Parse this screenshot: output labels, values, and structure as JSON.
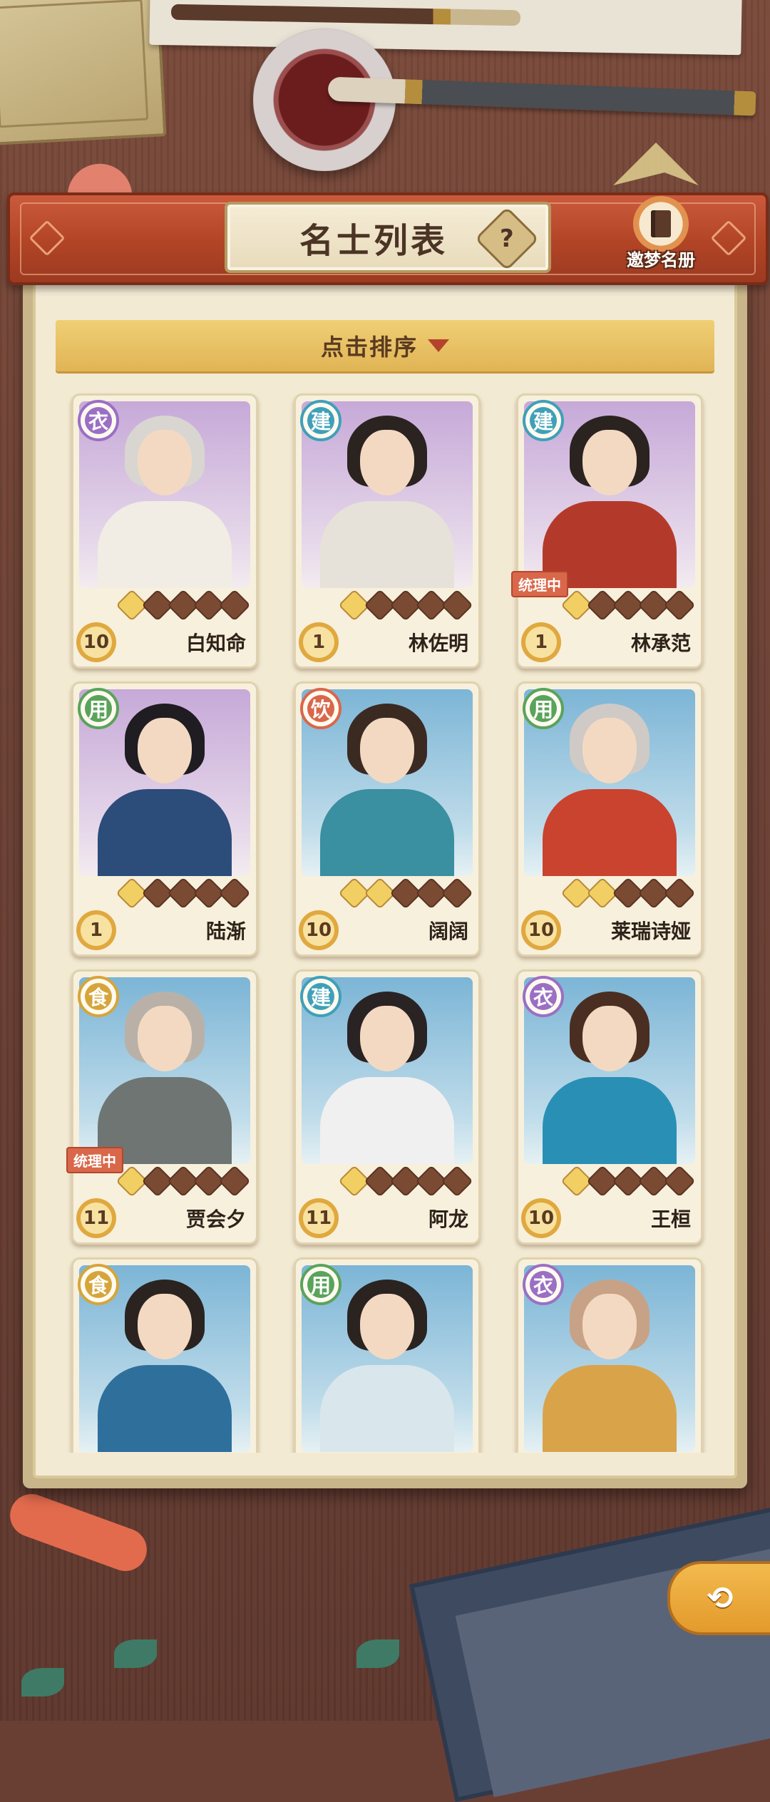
{
  "header": {
    "title": "名士列表",
    "help_icon_glyph": "?",
    "book_button_label": "邀梦名册"
  },
  "sort": {
    "label": "点击排序"
  },
  "status_tag_label": "统理中",
  "colors": {
    "header_red": "#b24426",
    "sort_gold": "#e0b455",
    "class_purple": "#9b6fc4",
    "class_teal": "#3fa0b8",
    "class_green": "#5aa35a",
    "class_red": "#d9674a",
    "class_gold": "#d6a53a"
  },
  "cards": [
    {
      "class_label": "衣",
      "class_color": "#9b6fc4",
      "level": "10",
      "stars": 1,
      "name": "白知命",
      "bg": "purple",
      "status": ""
    },
    {
      "class_label": "建",
      "class_color": "#3fa0b8",
      "level": "1",
      "stars": 1,
      "name": "林佐明",
      "bg": "purple",
      "status": ""
    },
    {
      "class_label": "建",
      "class_color": "#3fa0b8",
      "level": "1",
      "stars": 1,
      "name": "林承范",
      "bg": "purple",
      "status": "统理中"
    },
    {
      "class_label": "用",
      "class_color": "#5aa35a",
      "level": "1",
      "stars": 1,
      "name": "陆渐",
      "bg": "purple",
      "status": ""
    },
    {
      "class_label": "饮",
      "class_color": "#d9674a",
      "level": "10",
      "stars": 2,
      "name": "阔阔",
      "bg": "blue",
      "status": ""
    },
    {
      "class_label": "用",
      "class_color": "#5aa35a",
      "level": "10",
      "stars": 2,
      "name": "莱瑞诗娅",
      "bg": "blue",
      "status": ""
    },
    {
      "class_label": "食",
      "class_color": "#d6a53a",
      "level": "11",
      "stars": 1,
      "name": "贾会夕",
      "bg": "blue",
      "status": "统理中"
    },
    {
      "class_label": "建",
      "class_color": "#3fa0b8",
      "level": "11",
      "stars": 1,
      "name": "阿龙",
      "bg": "blue",
      "status": ""
    },
    {
      "class_label": "衣",
      "class_color": "#9b6fc4",
      "level": "10",
      "stars": 1,
      "name": "王桓",
      "bg": "blue",
      "status": ""
    },
    {
      "class_label": "食",
      "class_color": "#d6a53a",
      "level": "",
      "stars": 0,
      "name": "",
      "bg": "blue",
      "status": ""
    },
    {
      "class_label": "用",
      "class_color": "#5aa35a",
      "level": "",
      "stars": 0,
      "name": "",
      "bg": "blue",
      "status": ""
    },
    {
      "class_label": "衣",
      "class_color": "#9b6fc4",
      "level": "",
      "stars": 0,
      "name": "",
      "bg": "blue",
      "status": ""
    }
  ],
  "back_button_glyph": "⟲"
}
